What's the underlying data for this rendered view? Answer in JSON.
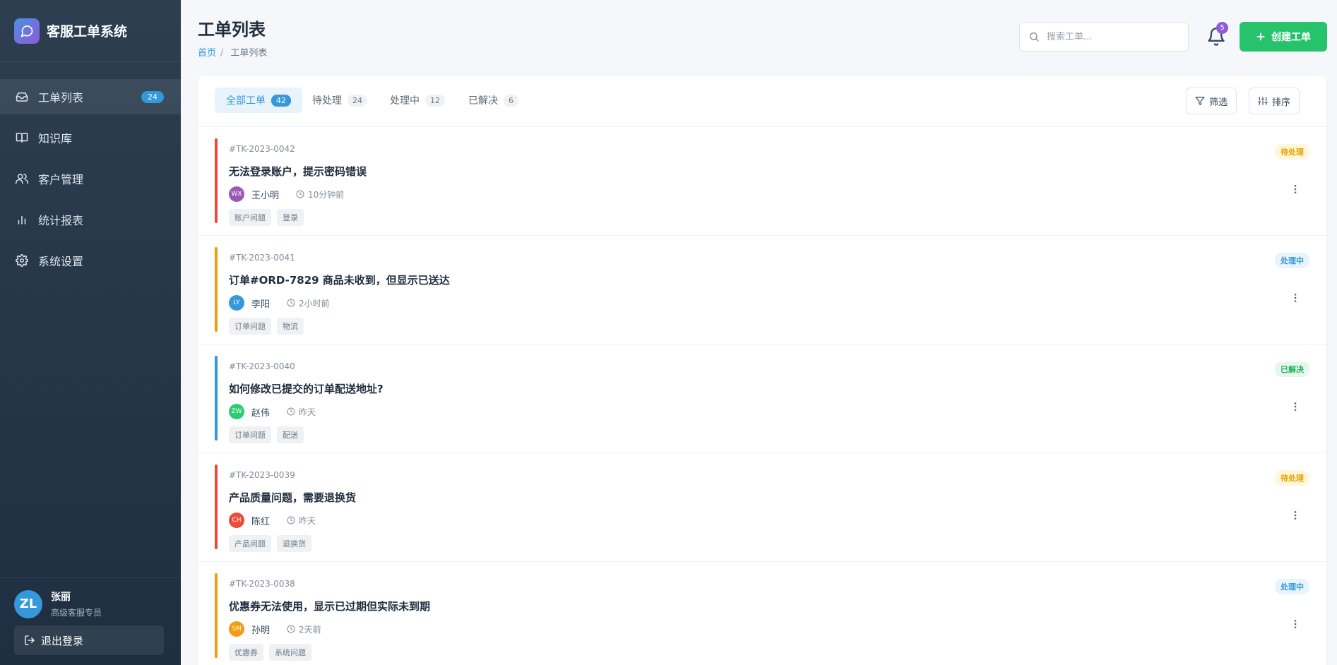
{
  "app": {
    "title": "客服工单系统"
  },
  "sidebar": {
    "items": [
      {
        "label": "工单列表",
        "badge": "24",
        "icon": "inbox-icon",
        "active": true
      },
      {
        "label": "知识库",
        "icon": "book-icon"
      },
      {
        "label": "客户管理",
        "icon": "users-icon"
      },
      {
        "label": "统计报表",
        "icon": "bar-chart-icon"
      },
      {
        "label": "系统设置",
        "icon": "gear-icon"
      }
    ],
    "user": {
      "initials": "ZL",
      "name": "张丽",
      "role": "高级客服专员"
    },
    "logout_label": "退出登录"
  },
  "header": {
    "title": "工单列表",
    "breadcrumb": {
      "home": "首页",
      "separator": "/",
      "current": "工单列表"
    },
    "search_placeholder": "搜索工单...",
    "notification_count": "5",
    "create_label": "创建工单"
  },
  "tabs": [
    {
      "label": "全部工单",
      "count": "42",
      "active": true
    },
    {
      "label": "待处理",
      "count": "24"
    },
    {
      "label": "处理中",
      "count": "12"
    },
    {
      "label": "已解决",
      "count": "6"
    }
  ],
  "toolbar": {
    "filter_label": "筛选",
    "sort_label": "排序"
  },
  "colors": {
    "pending": "#e74c3c",
    "processing": "#f39c12",
    "resolved": "#3498db",
    "accent": "#3498db",
    "create": "#27c26c"
  },
  "tickets": [
    {
      "id": "#TK-2023-0042",
      "title": "无法登录账户，提示密码错误",
      "user": "王小明",
      "initials": "WX",
      "avatar_color": "#9b59b6",
      "time": "10分钟前",
      "tags": [
        "账户问题",
        "登录"
      ],
      "status": "待处理",
      "status_kind": "pending",
      "bar_color": "#e74c3c"
    },
    {
      "id": "#TK-2023-0041",
      "title": "订单#ORD-7829 商品未收到，但显示已送达",
      "user": "李阳",
      "initials": "LY",
      "avatar_color": "#3498db",
      "time": "2小时前",
      "tags": [
        "订单问题",
        "物流"
      ],
      "status": "处理中",
      "status_kind": "processing",
      "bar_color": "#f39c12"
    },
    {
      "id": "#TK-2023-0040",
      "title": "如何修改已提交的订单配送地址?",
      "user": "赵伟",
      "initials": "ZW",
      "avatar_color": "#2ecc71",
      "time": "昨天",
      "tags": [
        "订单问题",
        "配送"
      ],
      "status": "已解决",
      "status_kind": "resolved",
      "bar_color": "#3498db"
    },
    {
      "id": "#TK-2023-0039",
      "title": "产品质量问题，需要退换货",
      "user": "陈红",
      "initials": "CH",
      "avatar_color": "#e74c3c",
      "time": "昨天",
      "tags": [
        "产品问题",
        "退换货"
      ],
      "status": "待处理",
      "status_kind": "pending",
      "bar_color": "#e74c3c"
    },
    {
      "id": "#TK-2023-0038",
      "title": "优惠券无法使用，显示已过期但实际未到期",
      "user": "孙明",
      "initials": "SM",
      "avatar_color": "#f39c12",
      "time": "2天前",
      "tags": [
        "优惠券",
        "系统问题"
      ],
      "status": "处理中",
      "status_kind": "processing",
      "bar_color": "#f39c12"
    }
  ]
}
